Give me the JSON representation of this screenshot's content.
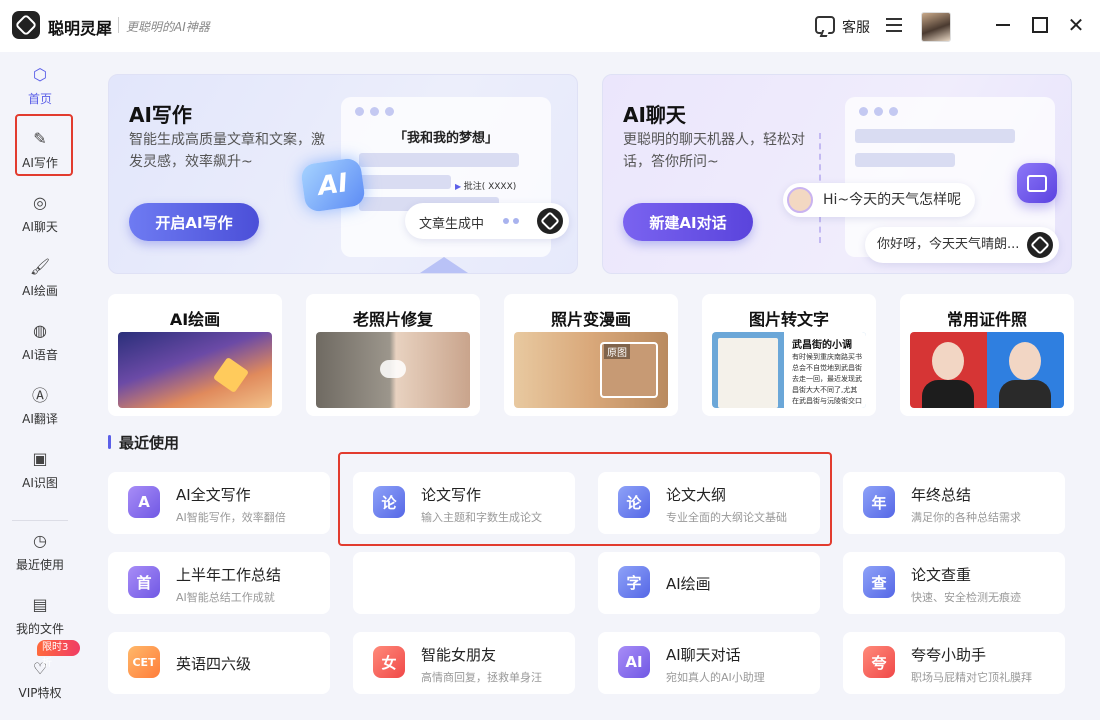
{
  "app": {
    "name": "聪明灵犀",
    "slogan": "更聪明的AI神器"
  },
  "header": {
    "service_label": "客服"
  },
  "sidebar": {
    "items": [
      {
        "label": "首页",
        "icon": "home-icon"
      },
      {
        "label": "AI写作",
        "icon": "pen-icon"
      },
      {
        "label": "AI聊天",
        "icon": "chat-icon"
      },
      {
        "label": "AI绘画",
        "icon": "brush-icon"
      },
      {
        "label": "AI语音",
        "icon": "voice-icon"
      },
      {
        "label": "AI翻译",
        "icon": "translate-icon"
      },
      {
        "label": "AI识图",
        "icon": "image-recognize-icon"
      },
      {
        "label": "最近使用",
        "icon": "history-icon"
      },
      {
        "label": "我的文件",
        "icon": "file-icon"
      },
      {
        "label": "VIP特权",
        "icon": "vip-icon"
      }
    ],
    "vip_badge": "限时3折"
  },
  "hero_write": {
    "title": "AI写作",
    "desc": "智能生成高质量文章和文案，激发灵感，效率飙升~",
    "button": "开启AI写作",
    "mock_title": "「我和我的梦想」",
    "mock_note": "批注( XXXX)",
    "ai_badge": "AI",
    "generating": "文章生成中"
  },
  "hero_chat": {
    "title": "AI聊天",
    "desc": "更聪明的聊天机器人，轻松对话，答你所问~",
    "button": "新建AI对话",
    "bubble_user": "Hi~今天的天气怎样呢",
    "bubble_bot": "你好呀，今天天气晴朗..."
  },
  "features": [
    {
      "title": "AI绘画"
    },
    {
      "title": "老照片修复"
    },
    {
      "title": "照片变漫画",
      "tag": "原图"
    },
    {
      "title": "图片转文字",
      "ocr_title": "武昌街的小调",
      "ocr_text": "有时候到重庆南路买书总会不自觉地到武昌街去走一回，最近发现武昌街大大不同了,尤其在武昌街与沅陵街交口一带"
    },
    {
      "title": "常用证件照"
    }
  ],
  "recent": {
    "title": "最近使用",
    "tools": [
      {
        "name": "AI全文写作",
        "desc": "AI智能写作，效率翻倍",
        "glyph": "A"
      },
      {
        "name": "论文写作",
        "desc": "输入主题和字数生成论文",
        "glyph": "论"
      },
      {
        "name": "论文大纲",
        "desc": "专业全面的大纲论文基础",
        "glyph": "论"
      },
      {
        "name": "年终总结",
        "desc": "满足你的各种总结需求",
        "glyph": "年"
      },
      {
        "name": "上半年工作总结",
        "desc": "AI智能总结工作成就",
        "glyph": "首"
      },
      {
        "name": "AI绘画",
        "desc": "",
        "glyph": "字"
      },
      {
        "name": "论文查重",
        "desc": "快速、安全检测无痕迹",
        "glyph": "查"
      },
      {
        "name": "英语四六级",
        "desc": "",
        "glyph": "CET"
      },
      {
        "name": "智能女朋友",
        "desc": "高情商回复，拯救单身汪",
        "glyph": "女"
      },
      {
        "name": "AI聊天对话",
        "desc": "宛如真人的AI小助理",
        "glyph": "AI"
      },
      {
        "name": "夸夸小助手",
        "desc": "职场马屁精对它顶礼膜拜",
        "glyph": "夸"
      }
    ]
  },
  "colors": {
    "accent": "#5b5fe8",
    "highlight_box": "#e23b2e"
  }
}
